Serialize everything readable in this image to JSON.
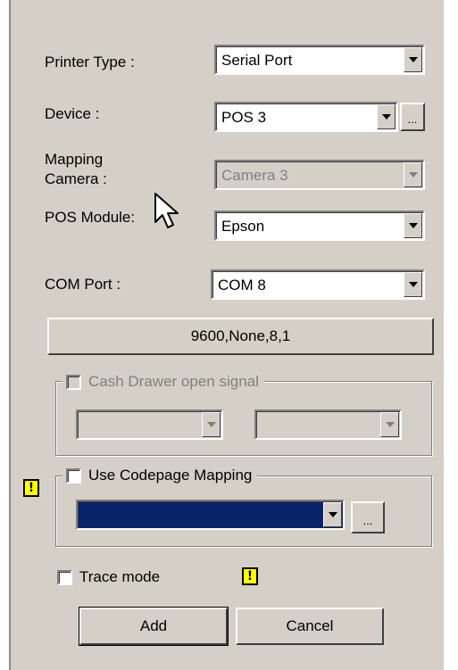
{
  "fields": {
    "printer_type_label": "Printer Type :",
    "printer_type_value": "Serial Port",
    "device_label": "Device :",
    "device_value": "POS 3",
    "device_browse_label": "...",
    "mapping_camera_label_line1": "Mapping",
    "mapping_camera_label_line2": "Camera :",
    "mapping_camera_value": "Camera 3",
    "pos_module_label": "POS Module:",
    "pos_module_value": "Epson",
    "com_port_label": "COM Port :",
    "com_port_value": "COM 8"
  },
  "serial_settings_button": "9600,None,8,1",
  "cash_drawer": {
    "title": "Cash Drawer open signal",
    "checked": false,
    "enabled": false,
    "left_value": "",
    "right_value": ""
  },
  "codepage": {
    "title": "Use Codepage Mapping",
    "checked": false,
    "selected_value": "",
    "browse_label": "..."
  },
  "trace_mode": {
    "label": "Trace mode",
    "checked": false
  },
  "actions": {
    "add_label": "Add",
    "cancel_label": "Cancel"
  },
  "warning_glyph": "!",
  "colors": {
    "panel_bg": "#d4d0c8",
    "codepage_selection": "#0a246a",
    "warning_yellow": "#ffff00",
    "disabled_text": "#808080"
  }
}
